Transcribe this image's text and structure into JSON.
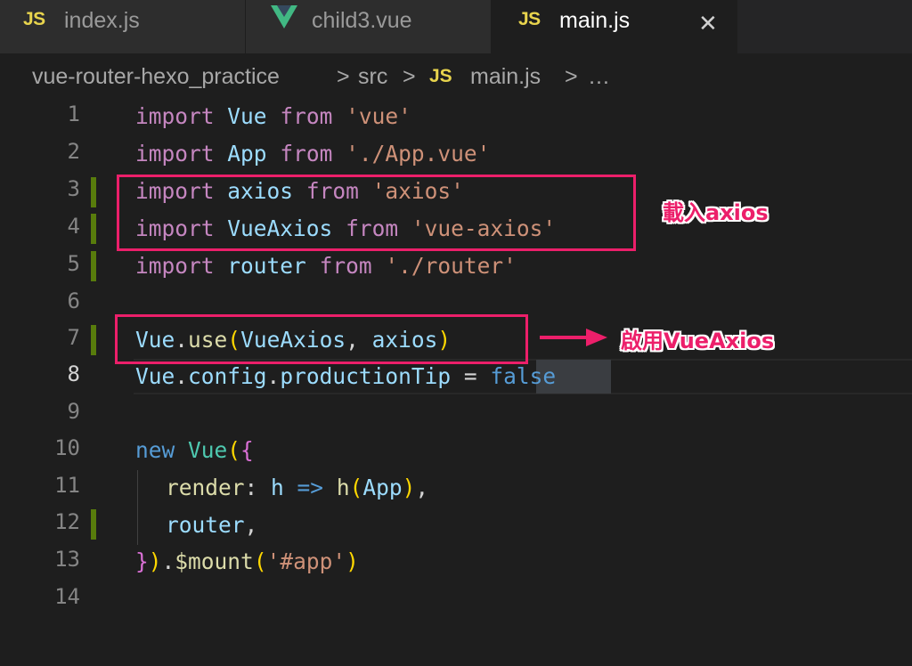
{
  "tabs": [
    {
      "label": "index.js",
      "icon": "js-icon",
      "badge": "JS"
    },
    {
      "label": "child3.vue",
      "icon": "vue-icon"
    },
    {
      "label": "main.js",
      "icon": "js-icon",
      "badge": "JS",
      "active": true,
      "close": "✕"
    }
  ],
  "breadcrumb": {
    "project": "vue-router-hexo_practice",
    "folder": "src",
    "badge": "JS",
    "file": "main.js",
    "sep": ">",
    "more": "…"
  },
  "gutter": [
    "1",
    "2",
    "3",
    "4",
    "5",
    "6",
    "7",
    "8",
    "9",
    "10",
    "11",
    "12",
    "13",
    "14"
  ],
  "code": {
    "l1": {
      "k": "import",
      "a": "Vue",
      "f": "from",
      "s": "'vue'"
    },
    "l2": {
      "k": "import",
      "a": "App",
      "f": "from",
      "s": "'./App.vue'"
    },
    "l3": {
      "k": "import",
      "a": "axios",
      "f": "from",
      "s": "'axios'"
    },
    "l4": {
      "k": "import",
      "a": "VueAxios",
      "f": "from",
      "s": "'vue-axios'"
    },
    "l5": {
      "k": "import",
      "a": "router",
      "f": "from",
      "s": "'./router'"
    },
    "l7": {
      "a": "Vue",
      "dot": ".",
      "m": "use",
      "p1": "(",
      "b": "VueAxios",
      "c": ", ",
      "d": "axios",
      "p2": ")"
    },
    "l8": {
      "a": "Vue",
      "d1": ".",
      "b": "config",
      "d2": ".",
      "c": "productionTip",
      "eq": " = ",
      "v": "false"
    },
    "l10": {
      "k": "new",
      "a": " Vue",
      "p": "(",
      "b": "{"
    },
    "l11": {
      "a": "render",
      "c": ": ",
      "b": "h",
      "ar": " => ",
      "f": "h",
      "p1": "(",
      "x": "App",
      "p2": ")",
      "cm": ","
    },
    "l12": {
      "a": "router",
      "cm": ","
    },
    "l13": {
      "b": "}",
      "p": ")",
      "d": ".",
      "m": "$mount",
      "p1": "(",
      "s": "'#app'",
      "p2": ")"
    }
  },
  "annotations": {
    "import_label": "載入axios",
    "use_label": "啟用VueAxios"
  },
  "colors": {
    "accent": "#ec1f6a",
    "js": "#e8d44d",
    "vue": "#41b883"
  }
}
